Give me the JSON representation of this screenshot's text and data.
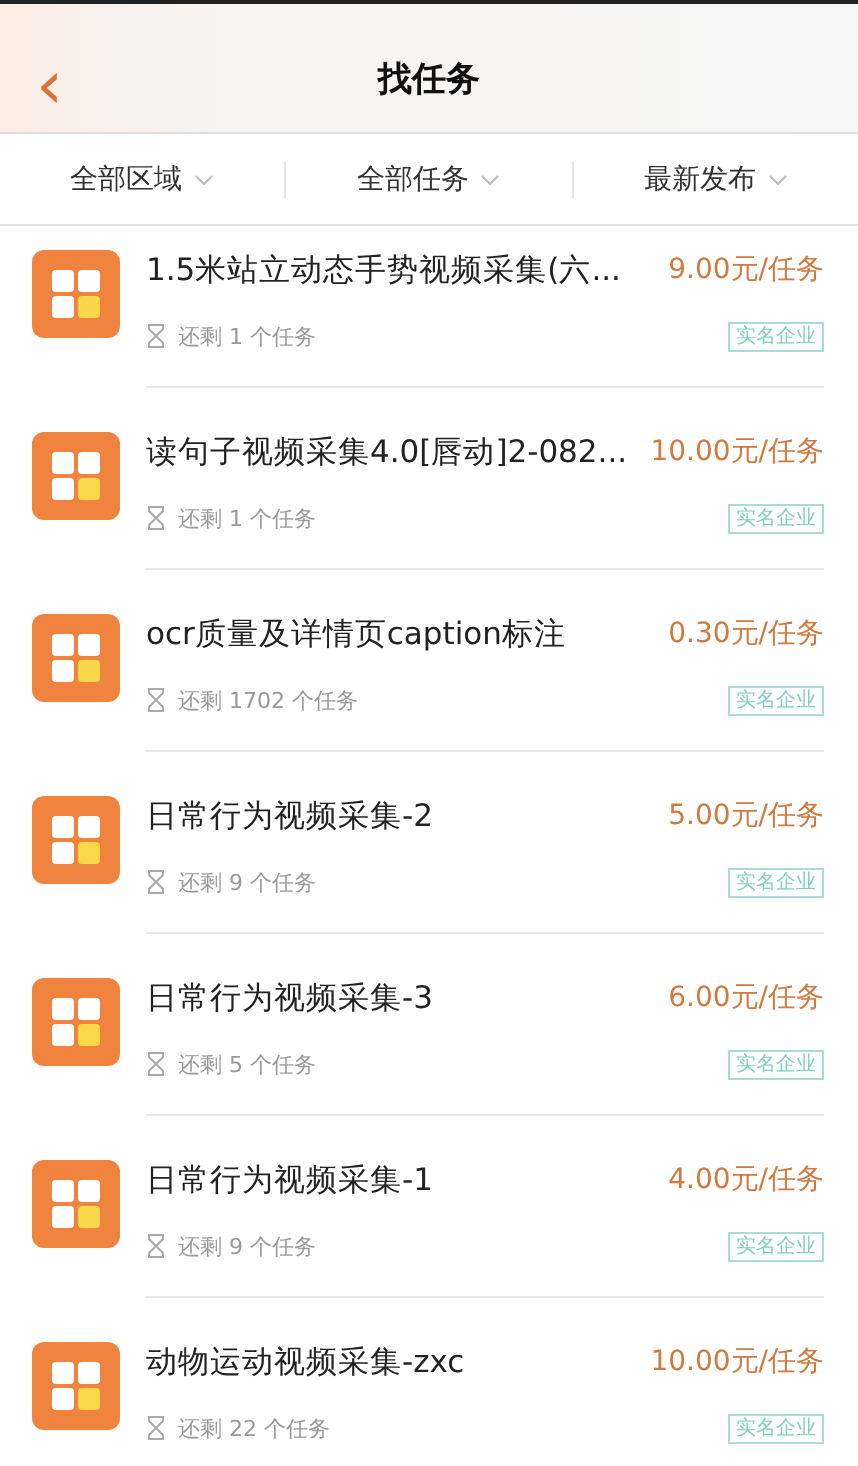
{
  "header": {
    "back_icon": "‹",
    "title": "找任务"
  },
  "filters": [
    {
      "label": "全部区域"
    },
    {
      "label": "全部任务"
    },
    {
      "label": "最新发布"
    }
  ],
  "tasks": [
    {
      "title": "1.5米站立动态手势视频采集(六...",
      "price": "9.00元/任务",
      "remaining": "还剩 1 个任务",
      "tag": "实名企业"
    },
    {
      "title": "读句子视频采集4.0[唇动]2-082...",
      "price": "10.00元/任务",
      "remaining": "还剩 1 个任务",
      "tag": "实名企业"
    },
    {
      "title": "ocr质量及详情页caption标注",
      "price": "0.30元/任务",
      "remaining": "还剩 1702 个任务",
      "tag": "实名企业"
    },
    {
      "title": "日常行为视频采集-2",
      "price": "5.00元/任务",
      "remaining": "还剩 9 个任务",
      "tag": "实名企业"
    },
    {
      "title": "日常行为视频采集-3",
      "price": "6.00元/任务",
      "remaining": "还剩 5 个任务",
      "tag": "实名企业"
    },
    {
      "title": "日常行为视频采集-1",
      "price": "4.00元/任务",
      "remaining": "还剩 9 个任务",
      "tag": "实名企业"
    },
    {
      "title": "动物运动视频采集-zxc",
      "price": "10.00元/任务",
      "remaining": "还剩 22 个任务",
      "tag": "实名企业"
    }
  ]
}
